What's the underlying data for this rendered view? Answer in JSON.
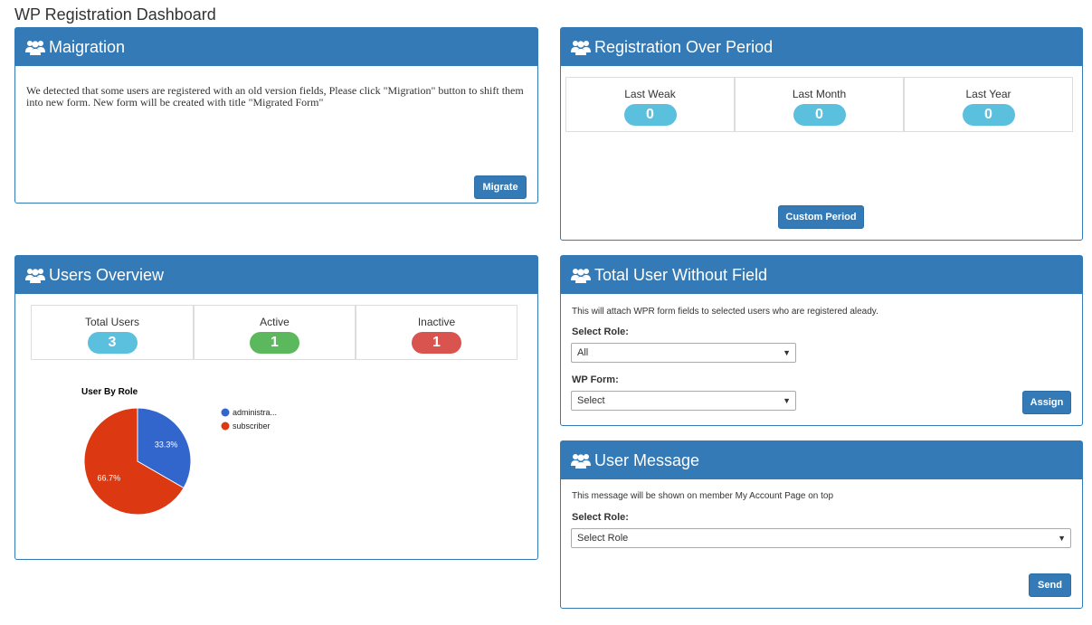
{
  "page": {
    "title": "WP Registration Dashboard"
  },
  "colors": {
    "primary": "#337ab7",
    "info": "#5bc0de",
    "success": "#5cb85c",
    "danger": "#d9534f",
    "chart_blue": "#3366cc",
    "chart_red": "#dc3912"
  },
  "migration": {
    "title": "Maigration",
    "message": "We detected that some users are registered with an old version fields, Please click \"Migration\" button to shift them into new form. New form will be created with title \"Migrated Form\"",
    "button": "Migrate"
  },
  "registration": {
    "title": "Registration Over Period",
    "stats": [
      {
        "label": "Last Weak",
        "value": "0"
      },
      {
        "label": "Last Month",
        "value": "0"
      },
      {
        "label": "Last Year",
        "value": "0"
      }
    ],
    "button": "Custom Period"
  },
  "users": {
    "title": "Users Overview",
    "stats": [
      {
        "label": "Total Users",
        "value": "3"
      },
      {
        "label": "Active",
        "value": "1"
      },
      {
        "label": "Inactive",
        "value": "1"
      }
    ]
  },
  "chart_data": {
    "type": "pie",
    "title": "User By Role",
    "categories": [
      "administra...",
      "subscriber"
    ],
    "values": [
      1,
      2
    ],
    "labels": [
      "33.3%",
      "66.7%"
    ],
    "colors": [
      "#3366cc",
      "#dc3912"
    ],
    "legend": "right"
  },
  "without_field": {
    "title": "Total User Without Field",
    "description": "This will attach WPR form fields to selected users who are registered aleady.",
    "role_label": "Select Role:",
    "role_value": "All",
    "form_label": "WP Form:",
    "form_value": "Select",
    "button": "Assign"
  },
  "message": {
    "title": "User Message",
    "description": "This message will be shown on member My Account Page on top",
    "role_label": "Select Role:",
    "role_value": "Select Role",
    "button": "Send"
  }
}
